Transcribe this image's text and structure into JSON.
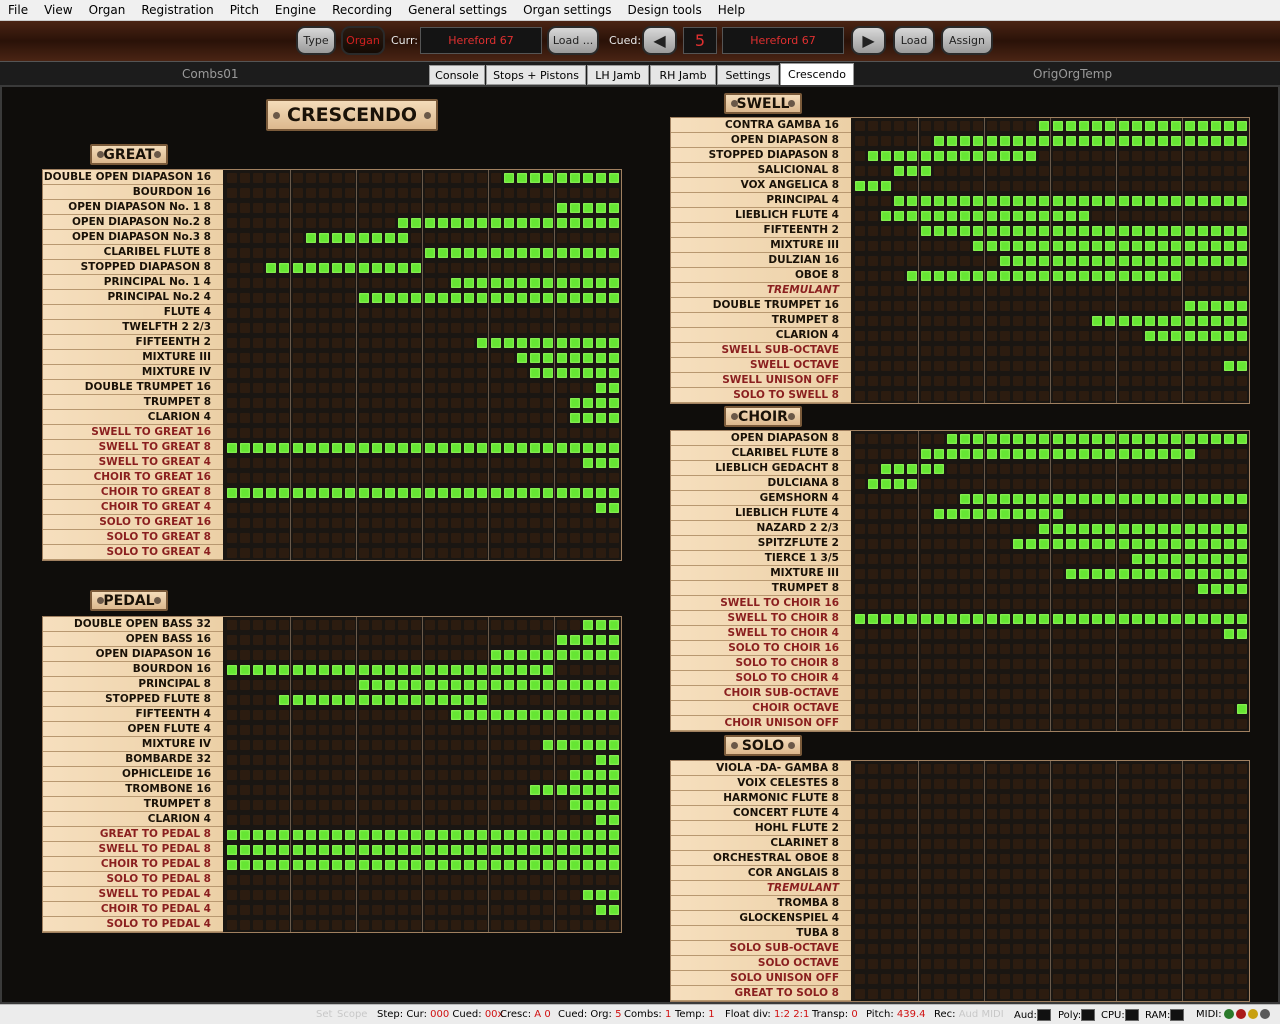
{
  "menu": [
    "File",
    "View",
    "Organ",
    "Registration",
    "Pitch",
    "Engine",
    "Recording",
    "General settings",
    "Organ settings",
    "Design tools",
    "Help"
  ],
  "toolbar": {
    "type_label": "Type",
    "organ_label": "Organ",
    "curr_label": "Curr:",
    "curr_value": "Hereford 67",
    "load1_label": "Load ...",
    "cued_label": "Cued:",
    "cued_number": "5",
    "cued_value": "Hereford 67",
    "load2_label": "Load",
    "assign_label": "Assign"
  },
  "tabs": {
    "left_name": "Combs01",
    "right_name": "OrigOrgTemp",
    "items": [
      "Console",
      "Stops + Pistons",
      "LH Jamb",
      "RH Jamb",
      "Settings",
      "Crescendo"
    ],
    "active": "Crescendo"
  },
  "page_title": "CRESCENDO",
  "divisions": [
    {
      "name": "GREAT",
      "rows": [
        {
          "label": "DOUBLE OPEN DIAPASON 16",
          "on_from": 22,
          "on_to": 30
        },
        {
          "label": "BOURDON 16",
          "on_from": null,
          "on_to": null
        },
        {
          "label": "OPEN DIAPASON No. 1  8",
          "on_from": 26,
          "on_to": 30
        },
        {
          "label": "OPEN DIAPASON No.2  8",
          "on_from": 14,
          "on_to": 30
        },
        {
          "label": "OPEN DIAPASON No.3  8",
          "on_from": 7,
          "on_to": 14
        },
        {
          "label": "CLARIBEL FLUTE  8",
          "on_from": 16,
          "on_to": 30
        },
        {
          "label": "STOPPED DIAPASON  8",
          "on_from": 4,
          "on_to": 15
        },
        {
          "label": "PRINCIPAL No. 1  4",
          "on_from": 18,
          "on_to": 30
        },
        {
          "label": "PRINCIPAL No.2  4",
          "on_from": 11,
          "on_to": 30
        },
        {
          "label": "FLUTE  4",
          "on_from": null,
          "on_to": null
        },
        {
          "label": "TWELFTH 2 2/3",
          "on_from": null,
          "on_to": null
        },
        {
          "label": "FIFTEENTH  2",
          "on_from": 20,
          "on_to": 30
        },
        {
          "label": "MIXTURE III",
          "on_from": 23,
          "on_to": 30
        },
        {
          "label": "MIXTURE IV",
          "on_from": 24,
          "on_to": 30
        },
        {
          "label": "DOUBLE TRUMPET 16",
          "on_from": 29,
          "on_to": 30
        },
        {
          "label": "TRUMPET  8",
          "on_from": 27,
          "on_to": 30
        },
        {
          "label": "CLARION  4",
          "on_from": 27,
          "on_to": 30
        },
        {
          "label": "SWELL TO GREAT  16",
          "on_from": null,
          "on_to": null,
          "kind": "cpl"
        },
        {
          "label": "SWELL TO GREAT  8",
          "on_from": 1,
          "on_to": 30,
          "kind": "cpl"
        },
        {
          "label": "SWELL TO GREAT  4",
          "on_from": 28,
          "on_to": 30,
          "kind": "cpl"
        },
        {
          "label": "CHOIR TO GREAT  16",
          "on_from": null,
          "on_to": null,
          "kind": "cpl"
        },
        {
          "label": "CHOIR TO GREAT  8",
          "on_from": 1,
          "on_to": 30,
          "kind": "cpl"
        },
        {
          "label": "CHOIR TO GREAT  4",
          "on_from": 29,
          "on_to": 30,
          "kind": "cpl"
        },
        {
          "label": "SOLO TO GREAT  16",
          "on_from": null,
          "on_to": null,
          "kind": "cpl"
        },
        {
          "label": "SOLO TO GREAT  8",
          "on_from": null,
          "on_to": null,
          "kind": "cpl"
        },
        {
          "label": "SOLO TO GREAT  4",
          "on_from": null,
          "on_to": null,
          "kind": "cpl"
        }
      ]
    },
    {
      "name": "PEDAL",
      "rows": [
        {
          "label": "DOUBLE OPEN BASS 32",
          "on_from": 28,
          "on_to": 30
        },
        {
          "label": "OPEN BASS 16",
          "on_from": 26,
          "on_to": 30
        },
        {
          "label": "OPEN DIAPASON 16",
          "on_from": 21,
          "on_to": 30
        },
        {
          "label": "BOURDON 16",
          "on_from": 1,
          "on_to": 25
        },
        {
          "label": "PRINCIPAL  8",
          "on_from": 11,
          "on_to": 30
        },
        {
          "label": "STOPPED FLUTE  8",
          "on_from": 5,
          "on_to": 20
        },
        {
          "label": "FIFTEENTH  4",
          "on_from": 18,
          "on_to": 30
        },
        {
          "label": "OPEN FLUTE  4",
          "on_from": null,
          "on_to": null
        },
        {
          "label": "MIXTURE  IV",
          "on_from": 25,
          "on_to": 30
        },
        {
          "label": "BOMBARDE 32",
          "on_from": 29,
          "on_to": 30
        },
        {
          "label": "OPHICLEIDE 16",
          "on_from": 27,
          "on_to": 30
        },
        {
          "label": "TROMBONE 16",
          "on_from": 24,
          "on_to": 30
        },
        {
          "label": "TRUMPET  8",
          "on_from": 27,
          "on_to": 30
        },
        {
          "label": "CLARION  4",
          "on_from": 29,
          "on_to": 30
        },
        {
          "label": "GREAT TO PEDAL  8",
          "on_from": 1,
          "on_to": 30,
          "kind": "cpl"
        },
        {
          "label": "SWELL TO PEDAL  8",
          "on_from": 1,
          "on_to": 30,
          "kind": "cpl"
        },
        {
          "label": "CHOIR TO PEDAL  8",
          "on_from": 1,
          "on_to": 30,
          "kind": "cpl"
        },
        {
          "label": "SOLO TO PEDAL  8",
          "on_from": null,
          "on_to": null,
          "kind": "cpl"
        },
        {
          "label": "SWELL TO PEDAL  4",
          "on_from": 28,
          "on_to": 30,
          "kind": "cpl"
        },
        {
          "label": "CHOIR TO PEDAL  4",
          "on_from": 29,
          "on_to": 30,
          "kind": "cpl"
        },
        {
          "label": "SOLO TO PEDAL  4",
          "on_from": null,
          "on_to": null,
          "kind": "cpl"
        }
      ]
    },
    {
      "name": "SWELL",
      "rows": [
        {
          "label": "CONTRA GAMBA 16",
          "on_from": 15,
          "on_to": 30
        },
        {
          "label": "OPEN DIAPASON  8",
          "on_from": 7,
          "on_to": 30
        },
        {
          "label": "STOPPED DIAPASON  8",
          "on_from": 2,
          "on_to": 14
        },
        {
          "label": "SALICIONAL  8",
          "on_from": 4,
          "on_to": 6
        },
        {
          "label": "VOX ANGELICA  8",
          "on_from": 1,
          "on_to": 3
        },
        {
          "label": "PRINCIPAL  4",
          "on_from": 4,
          "on_to": 30
        },
        {
          "label": "LIEBLICH FLUTE  4",
          "on_from": 3,
          "on_to": 18
        },
        {
          "label": "FIFTEENTH  2",
          "on_from": 6,
          "on_to": 30
        },
        {
          "label": "MIXTURE III",
          "on_from": 10,
          "on_to": 30
        },
        {
          "label": "DULZIAN 16",
          "on_from": 12,
          "on_to": 30
        },
        {
          "label": "OBOE  8",
          "on_from": 5,
          "on_to": 25
        },
        {
          "label": "TREMULANT",
          "on_from": null,
          "on_to": null,
          "kind": "trem"
        },
        {
          "label": "DOUBLE TRUMPET 16",
          "on_from": 26,
          "on_to": 30
        },
        {
          "label": "TRUMPET  8",
          "on_from": 19,
          "on_to": 30
        },
        {
          "label": "CLARION  4",
          "on_from": 23,
          "on_to": 30
        },
        {
          "label": "SWELL SUB-OCTAVE",
          "on_from": null,
          "on_to": null,
          "kind": "cpl"
        },
        {
          "label": "SWELL OCTAVE",
          "on_from": 29,
          "on_to": 30,
          "kind": "cpl"
        },
        {
          "label": "SWELL UNISON OFF",
          "on_from": null,
          "on_to": null,
          "kind": "cpl"
        },
        {
          "label": "SOLO TO SWELL  8",
          "on_from": null,
          "on_to": null,
          "kind": "cpl"
        }
      ]
    },
    {
      "name": "CHOIR",
      "rows": [
        {
          "label": "OPEN DIAPASON  8",
          "on_from": 8,
          "on_to": 30
        },
        {
          "label": "CLARIBEL FLUTE  8",
          "on_from": 6,
          "on_to": 26
        },
        {
          "label": "LIEBLICH GEDACHT  8",
          "on_from": 3,
          "on_to": 7
        },
        {
          "label": "DULCIANA  8",
          "on_from": 2,
          "on_to": 5
        },
        {
          "label": "GEMSHORN  4",
          "on_from": 9,
          "on_to": 30
        },
        {
          "label": "LIEBLICH FLUTE  4",
          "on_from": 7,
          "on_to": 16
        },
        {
          "label": "NAZARD 2 2/3",
          "on_from": 15,
          "on_to": 30
        },
        {
          "label": "SPITZFLUTE  2",
          "on_from": 13,
          "on_to": 30
        },
        {
          "label": "TIERCE  1 3/5",
          "on_from": 22,
          "on_to": 30
        },
        {
          "label": "MIXTURE III",
          "on_from": 17,
          "on_to": 30
        },
        {
          "label": "TRUMPET  8",
          "on_from": 27,
          "on_to": 30
        },
        {
          "label": "SWELL TO CHOIR  16",
          "on_from": null,
          "on_to": null,
          "kind": "cpl"
        },
        {
          "label": "SWELL TO CHOIR  8",
          "on_from": 1,
          "on_to": 30,
          "kind": "cpl"
        },
        {
          "label": "SWELL TO CHOIR  4",
          "on_from": 29,
          "on_to": 30,
          "kind": "cpl"
        },
        {
          "label": "SOLO TO CHOIR  16",
          "on_from": null,
          "on_to": null,
          "kind": "cpl"
        },
        {
          "label": "SOLO TO CHOIR  8",
          "on_from": null,
          "on_to": null,
          "kind": "cpl"
        },
        {
          "label": "SOLO TO CHOIR  4",
          "on_from": null,
          "on_to": null,
          "kind": "cpl"
        },
        {
          "label": "CHOIR SUB-OCTAVE",
          "on_from": null,
          "on_to": null,
          "kind": "cpl"
        },
        {
          "label": "CHOIR OCTAVE",
          "on_from": 30,
          "on_to": 30,
          "kind": "cpl"
        },
        {
          "label": "CHOIR UNISON OFF",
          "on_from": null,
          "on_to": null,
          "kind": "cpl"
        }
      ]
    },
    {
      "name": "SOLO",
      "rows": [
        {
          "label": "VIOLA -DA- GAMBA  8",
          "on_from": null,
          "on_to": null
        },
        {
          "label": "VOIX CELESTES  8",
          "on_from": null,
          "on_to": null
        },
        {
          "label": "HARMONIC FLUTE  8",
          "on_from": null,
          "on_to": null
        },
        {
          "label": "CONCERT FLUTE  4",
          "on_from": null,
          "on_to": null
        },
        {
          "label": "HOHL FLUTE  2",
          "on_from": null,
          "on_to": null
        },
        {
          "label": "CLARINET  8",
          "on_from": null,
          "on_to": null
        },
        {
          "label": "ORCHESTRAL OBOE  8",
          "on_from": null,
          "on_to": null
        },
        {
          "label": "COR ANGLAIS  8",
          "on_from": null,
          "on_to": null
        },
        {
          "label": "TREMULANT",
          "on_from": null,
          "on_to": null,
          "kind": "trem"
        },
        {
          "label": "TROMBA  8",
          "on_from": null,
          "on_to": null
        },
        {
          "label": "GLOCKENSPIEL  4",
          "on_from": null,
          "on_to": null
        },
        {
          "label": "TUBA  8",
          "on_from": null,
          "on_to": null
        },
        {
          "label": "SOLO SUB-OCTAVE",
          "on_from": null,
          "on_to": null,
          "kind": "cpl"
        },
        {
          "label": "SOLO OCTAVE",
          "on_from": null,
          "on_to": null,
          "kind": "cpl"
        },
        {
          "label": "SOLO UNISON OFF",
          "on_from": null,
          "on_to": null,
          "kind": "cpl"
        },
        {
          "label": "GREAT TO SOLO  8",
          "on_from": null,
          "on_to": null,
          "kind": "cpl"
        }
      ]
    }
  ],
  "status": {
    "set": "Set",
    "scope": "Scope",
    "step_label": "Step: Cur:",
    "step_cur": "000",
    "step_cued_label": "Cued:",
    "step_cued": "00x",
    "cresc_label": "Cresc:",
    "cresc_value": "A 0",
    "cued_org_label": "Cued: Org:",
    "cued_org": "5",
    "combs_label": "Combs:",
    "combs": "1",
    "temp_label": "Temp:",
    "temp": "1",
    "float_label": "Float div:",
    "float": "1:2 2:1",
    "transp_label": "Transp:",
    "transp": "0",
    "pitch_label": "Pitch:",
    "pitch": "439.4",
    "rec_label": "Rec:",
    "rec_aud": "Aud",
    "rec_midi": "MIDI",
    "aud_label": "Aud:",
    "poly_label": "Poly:",
    "cpu_label": "CPU:",
    "ram_label": "RAM:",
    "midi_label": "MIDI:",
    "led_colors": [
      "#2a7a2a",
      "#aa1a1a",
      "#c8a010",
      "#5a5a5a"
    ]
  },
  "colors": {
    "step_on": "#66e633",
    "step_off": "#2c1c10",
    "coupler_text": "#8a1f1f",
    "label_bg": "#f6dfbe"
  }
}
